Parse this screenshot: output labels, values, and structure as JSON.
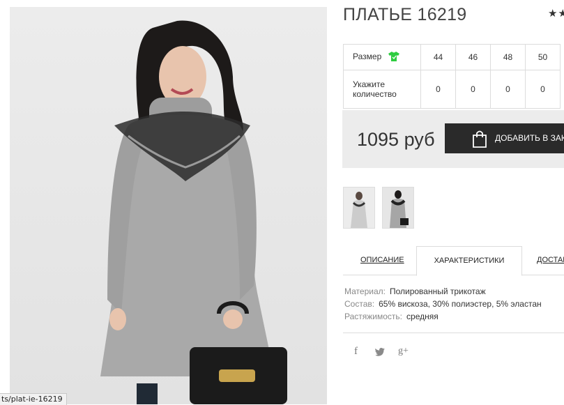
{
  "product": {
    "title": "ПЛАТЬЕ 16219",
    "rating_stars": "★★"
  },
  "size_table": {
    "size_label": "Размер",
    "quantity_label_line1": "Укажите",
    "quantity_label_line2": "количество",
    "sizes": [
      "44",
      "46",
      "48",
      "50"
    ],
    "quantities": [
      "0",
      "0",
      "0",
      "0"
    ],
    "size_icon": "tshirt-icon",
    "size_icon_color": "#2ecc40"
  },
  "purchase": {
    "price": "1095 руб",
    "add_to_cart_label": "ДОБАВИТЬ В ЗАКАЗ",
    "cart_icon": "shopping-bag-icon"
  },
  "tabs": [
    {
      "label": "ОПИСАНИЕ",
      "active": false
    },
    {
      "label": "ХАРАКТЕРИСТИКИ",
      "active": true
    },
    {
      "label": "ДОСТАВКА",
      "active": false
    }
  ],
  "specs": [
    {
      "key": "Материал:",
      "value": "Полированный трикотаж"
    },
    {
      "key": "Состав:",
      "value": "65% вискоза, 30% полиэстер, 5% эластан"
    },
    {
      "key": "Растяжимость:",
      "value": "средняя"
    }
  ],
  "social": {
    "facebook": "f",
    "twitter": "🐦",
    "google_plus": "g+"
  },
  "status_bar": {
    "url": "ts/plat-ie-16219"
  },
  "colors": {
    "dark_button": "#2a2a2a",
    "price_box": "#ececec",
    "dress_gray": "#a9a9a9"
  }
}
